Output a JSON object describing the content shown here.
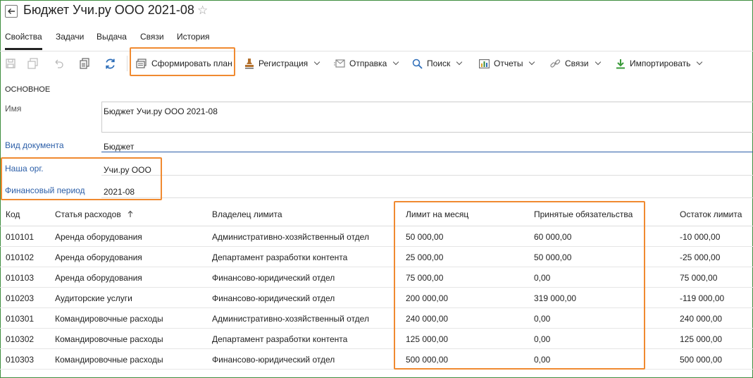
{
  "header": {
    "title": "Бюджет Учи.ру ООО 2021-08"
  },
  "tabs": [
    {
      "label": "Свойства",
      "active": true
    },
    {
      "label": "Задачи"
    },
    {
      "label": "Выдача"
    },
    {
      "label": "Связи"
    },
    {
      "label": "История"
    }
  ],
  "toolbar": {
    "generate_plan": "Сформировать план",
    "registration": "Регистрация",
    "sending": "Отправка",
    "search": "Поиск",
    "reports": "Отчеты",
    "links": "Связи",
    "import": "Импортировать"
  },
  "form": {
    "section": "ОСНОВНОЕ",
    "name_label": "Имя",
    "name_value": "Бюджет Учи.ру ООО 2021-08",
    "doc_type_label": "Вид документа",
    "doc_type_value": "Бюджет",
    "org_label": "Наша орг.",
    "org_value": "Учи.ру ООО",
    "period_label": "Финансовый период",
    "period_value": "2021-08"
  },
  "table": {
    "columns": {
      "code": "Код",
      "article": "Статья расходов",
      "owner": "Владелец лимита",
      "limit": "Лимит на месяц",
      "commitments": "Принятые обязательства",
      "remainder": "Остаток лимита"
    },
    "rows": [
      {
        "code": "010101",
        "article": "Аренда оборудования",
        "owner": "Административно-хозяйственный отдел",
        "limit": "50 000,00",
        "commitments": "60 000,00",
        "remainder": "-10 000,00"
      },
      {
        "code": "010102",
        "article": "Аренда оборудования",
        "owner": "Департамент разработки контента",
        "limit": "25 000,00",
        "commitments": "50 000,00",
        "remainder": "-25 000,00"
      },
      {
        "code": "010103",
        "article": "Аренда оборудования",
        "owner": "Финансово-юридический отдел",
        "limit": "75 000,00",
        "commitments": "0,00",
        "remainder": "75 000,00"
      },
      {
        "code": "010203",
        "article": "Аудиторские услуги",
        "owner": "Финансово-юридический отдел",
        "limit": "200 000,00",
        "commitments": "319 000,00",
        "remainder": "-119 000,00"
      },
      {
        "code": "010301",
        "article": "Командировочные расходы",
        "owner": "Административно-хозяйственный отдел",
        "limit": "240 000,00",
        "commitments": "0,00",
        "remainder": "240 000,00"
      },
      {
        "code": "010302",
        "article": "Командировочные расходы",
        "owner": "Департамент разработки контента",
        "limit": "125 000,00",
        "commitments": "0,00",
        "remainder": "125 000,00"
      },
      {
        "code": "010303",
        "article": "Командировочные расходы",
        "owner": "Финансово-юридический отдел",
        "limit": "500 000,00",
        "commitments": "0,00",
        "remainder": "500 000,00"
      }
    ]
  },
  "colors": {
    "highlight": "#f08a30",
    "link": "#2b5ea8",
    "frame": "#3f8e3f"
  }
}
